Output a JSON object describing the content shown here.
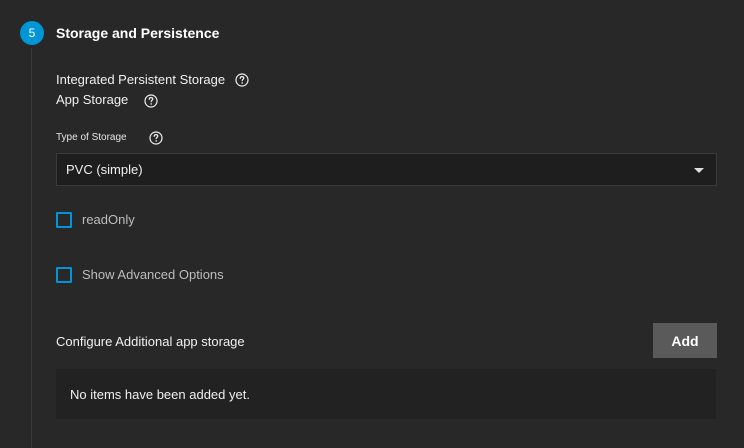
{
  "section": {
    "step_number": "5",
    "title": "Storage and Persistence"
  },
  "storage": {
    "group_label": "Integrated Persistent Storage",
    "app_storage_label": "App Storage",
    "type_label": "Type of Storage",
    "type_value": "PVC (simple)"
  },
  "options": {
    "read_only_label": "readOnly",
    "show_advanced_label": "Show Advanced Options"
  },
  "additional": {
    "label": "Configure Additional app storage",
    "add_button": "Add",
    "empty_message": "No items have been added yet."
  },
  "colors": {
    "accent": "#0095d5",
    "background": "#282828",
    "input_background": "#1e1e1e",
    "button_background": "#5a5a5a"
  },
  "icons": {
    "help": "help-circle-icon",
    "dropdown": "caret-down-icon"
  }
}
